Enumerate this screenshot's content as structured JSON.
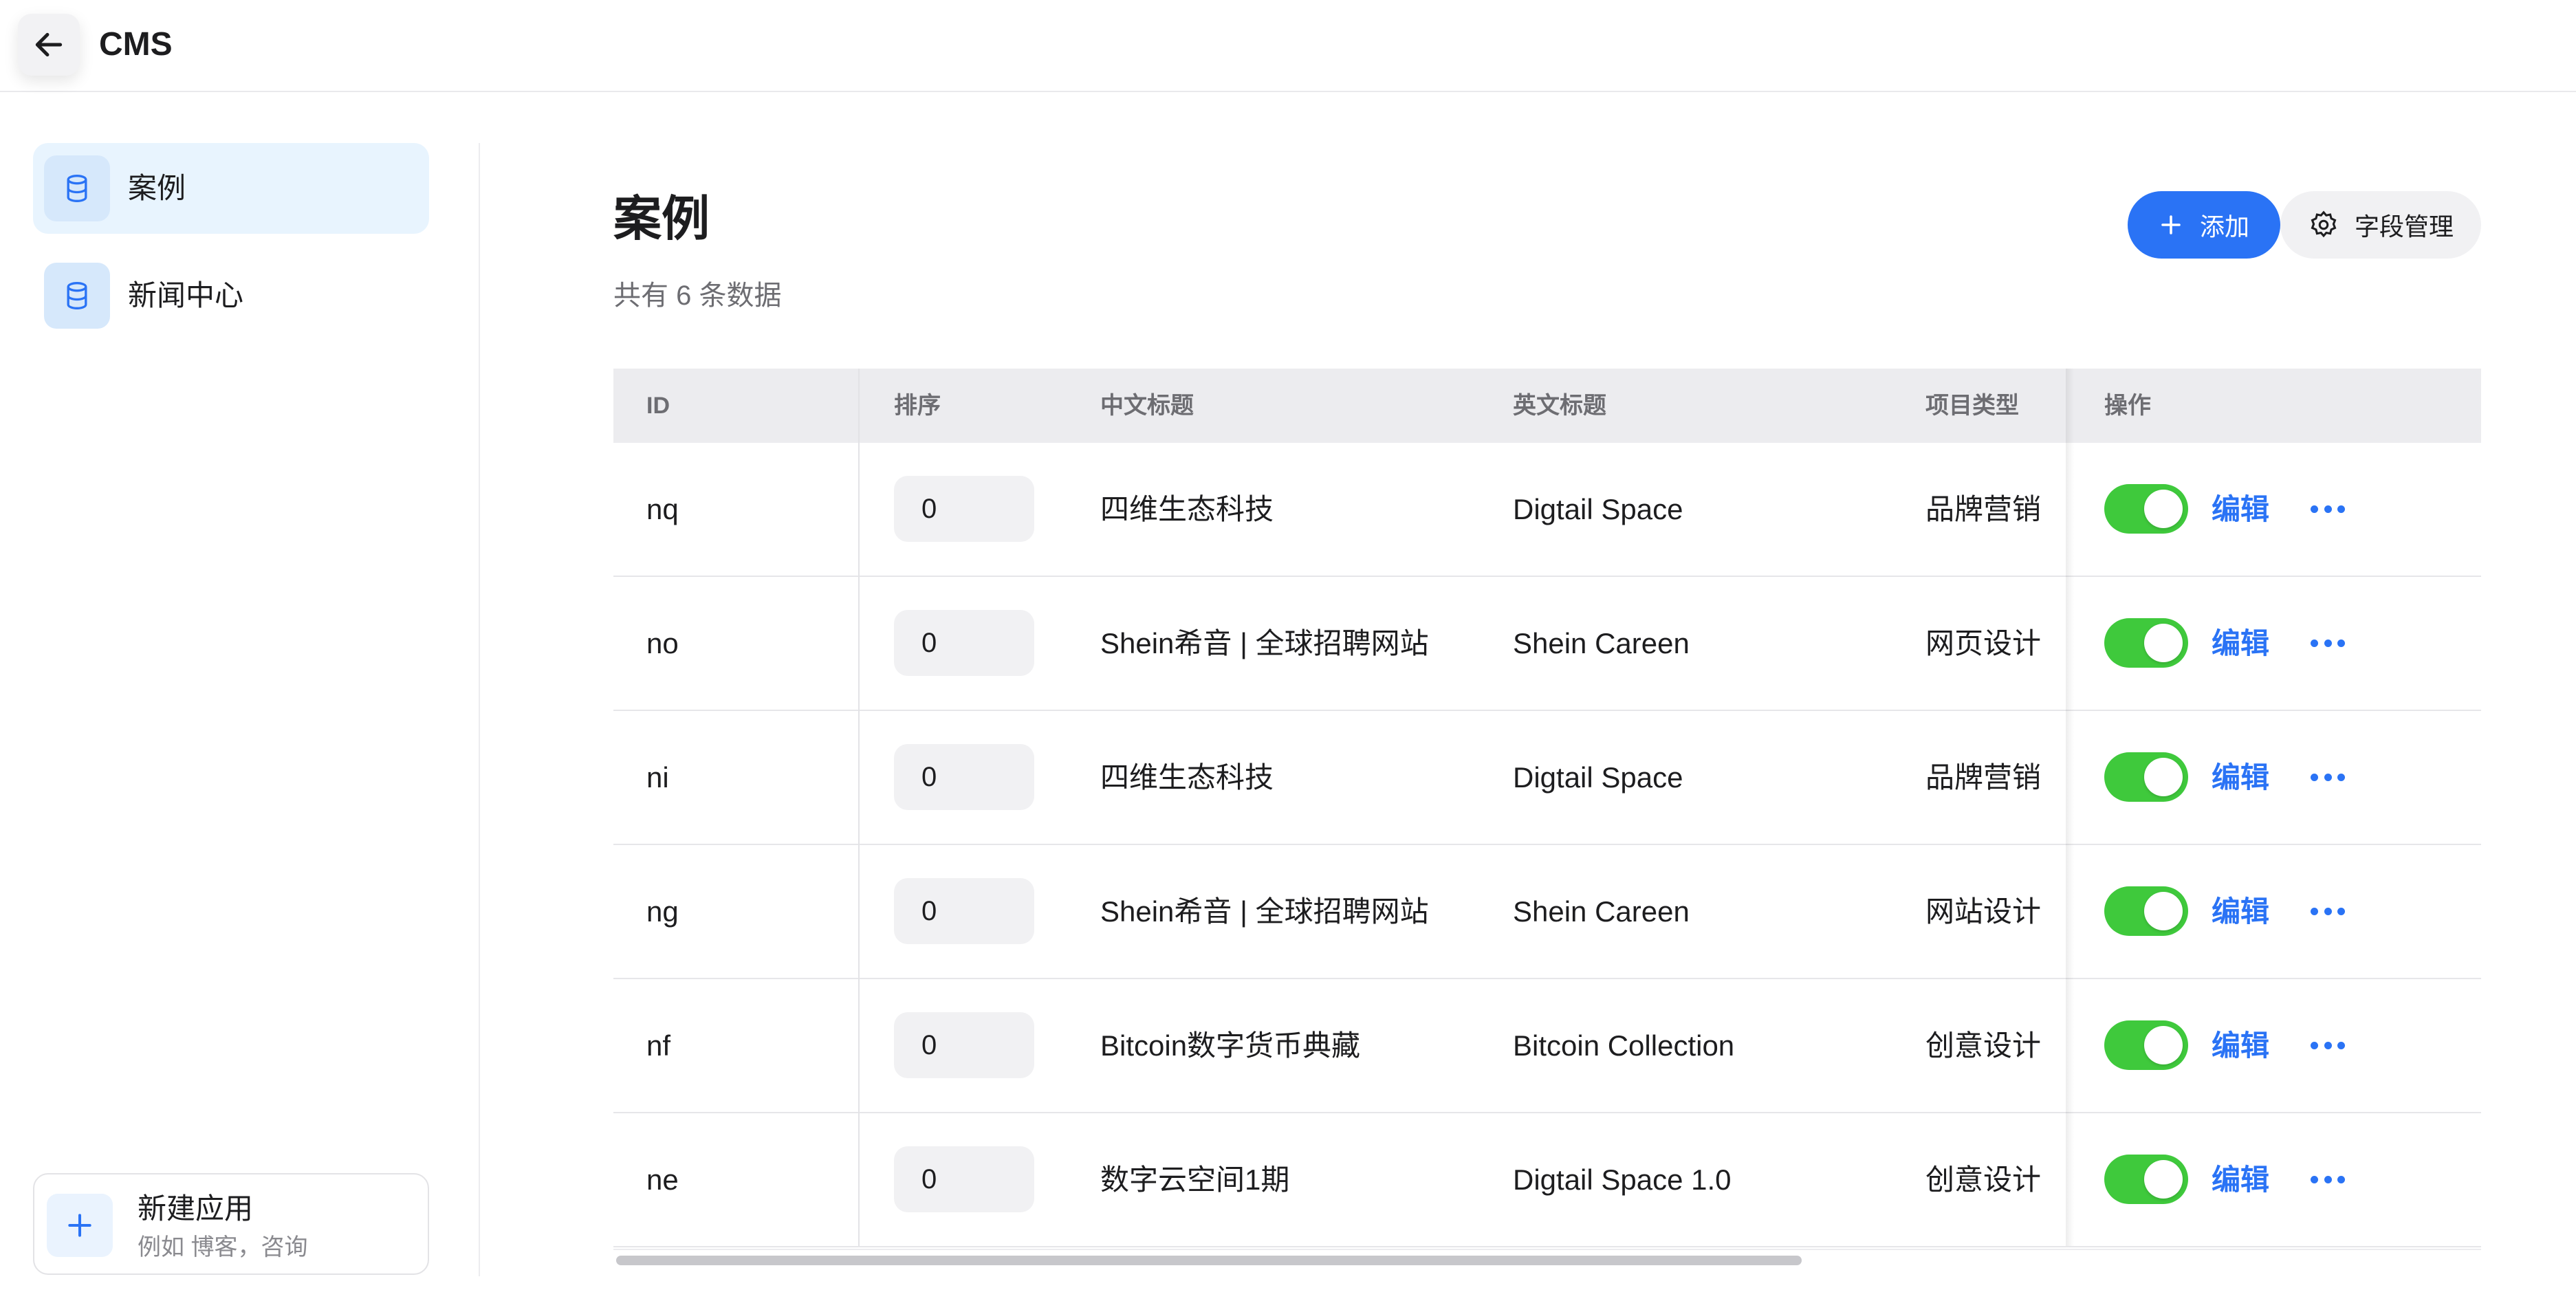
{
  "app": {
    "title": "CMS"
  },
  "sidebar": {
    "items": [
      {
        "label": "案例",
        "icon": "database-icon",
        "active": true
      },
      {
        "label": "新闻中心",
        "icon": "database-icon",
        "active": false
      }
    ],
    "new_app": {
      "title": "新建应用",
      "hint": "例如 博客，咨询",
      "icon": "plus-icon"
    }
  },
  "main": {
    "title": "案例",
    "subtitle": "共有 6 条数据",
    "add_label": "添加",
    "field_manage_label": "字段管理"
  },
  "table": {
    "columns": [
      "ID",
      "排序",
      "中文标题",
      "英文标题",
      "项目类型",
      "操作"
    ],
    "rows": [
      {
        "id": "nq",
        "sort": "0",
        "cn_title": "四维生态科技",
        "en_title": "Digtail Space",
        "type": "品牌营销",
        "enabled": true,
        "edit": "编辑"
      },
      {
        "id": "no",
        "sort": "0",
        "cn_title": "Shein希音 | 全球招聘网站",
        "en_title": "Shein Careen",
        "type": "网页设计",
        "enabled": true,
        "edit": "编辑"
      },
      {
        "id": "ni",
        "sort": "0",
        "cn_title": "四维生态科技",
        "en_title": "Digtail Space",
        "type": "品牌营销",
        "enabled": true,
        "edit": "编辑"
      },
      {
        "id": "ng",
        "sort": "0",
        "cn_title": "Shein希音 | 全球招聘网站",
        "en_title": "Shein Careen",
        "type": "网站设计",
        "enabled": true,
        "edit": "编辑"
      },
      {
        "id": "nf",
        "sort": "0",
        "cn_title": "Bitcoin数字货币典藏",
        "en_title": "Bitcoin Collection",
        "type": "创意设计",
        "enabled": true,
        "edit": "编辑"
      },
      {
        "id": "ne",
        "sort": "0",
        "cn_title": "数字云空间1期",
        "en_title": "Digtail Space 1.0",
        "type": "创意设计",
        "enabled": true,
        "edit": "编辑"
      }
    ]
  },
  "colors": {
    "accent": "#2a73f5",
    "toggle_on": "#3fc93c",
    "active_bg": "#e8f4fe"
  }
}
